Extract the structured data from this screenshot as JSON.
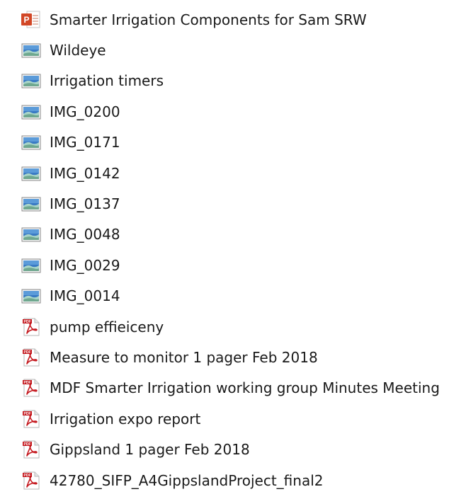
{
  "files": [
    {
      "name": "Smarter Irrigation Components for Sam SRW",
      "icon": "powerpoint-icon",
      "type": "ppt"
    },
    {
      "name": "Wildeye",
      "icon": "image-file-icon",
      "type": "img"
    },
    {
      "name": "Irrigation timers",
      "icon": "image-file-icon",
      "type": "img"
    },
    {
      "name": "IMG_0200",
      "icon": "image-file-icon",
      "type": "img"
    },
    {
      "name": "IMG_0171",
      "icon": "image-file-icon",
      "type": "img"
    },
    {
      "name": "IMG_0142",
      "icon": "image-file-icon",
      "type": "img"
    },
    {
      "name": "IMG_0137",
      "icon": "image-file-icon",
      "type": "img"
    },
    {
      "name": "IMG_0048",
      "icon": "image-file-icon",
      "type": "img"
    },
    {
      "name": "IMG_0029",
      "icon": "image-file-icon",
      "type": "img"
    },
    {
      "name": "IMG_0014",
      "icon": "image-file-icon",
      "type": "img"
    },
    {
      "name": "pump effieiceny",
      "icon": "pdf-icon",
      "type": "pdf"
    },
    {
      "name": "Measure to monitor 1 pager Feb 2018",
      "icon": "pdf-icon",
      "type": "pdf"
    },
    {
      "name": "MDF Smarter Irrigation working group Minutes Meeting",
      "icon": "pdf-icon",
      "type": "pdf"
    },
    {
      "name": "Irrigation expo report",
      "icon": "pdf-icon",
      "type": "pdf"
    },
    {
      "name": "Gippsland 1 pager Feb 2018",
      "icon": "pdf-icon",
      "type": "pdf"
    },
    {
      "name": "42780_SIFP_A4GippslandProject_final2",
      "icon": "pdf-icon",
      "type": "pdf"
    }
  ],
  "colors": {
    "ppt_red": "#d24726",
    "pdf_red": "#c4161c",
    "img_sky": "#3a7ac4",
    "img_land": "#7fb3a0"
  }
}
